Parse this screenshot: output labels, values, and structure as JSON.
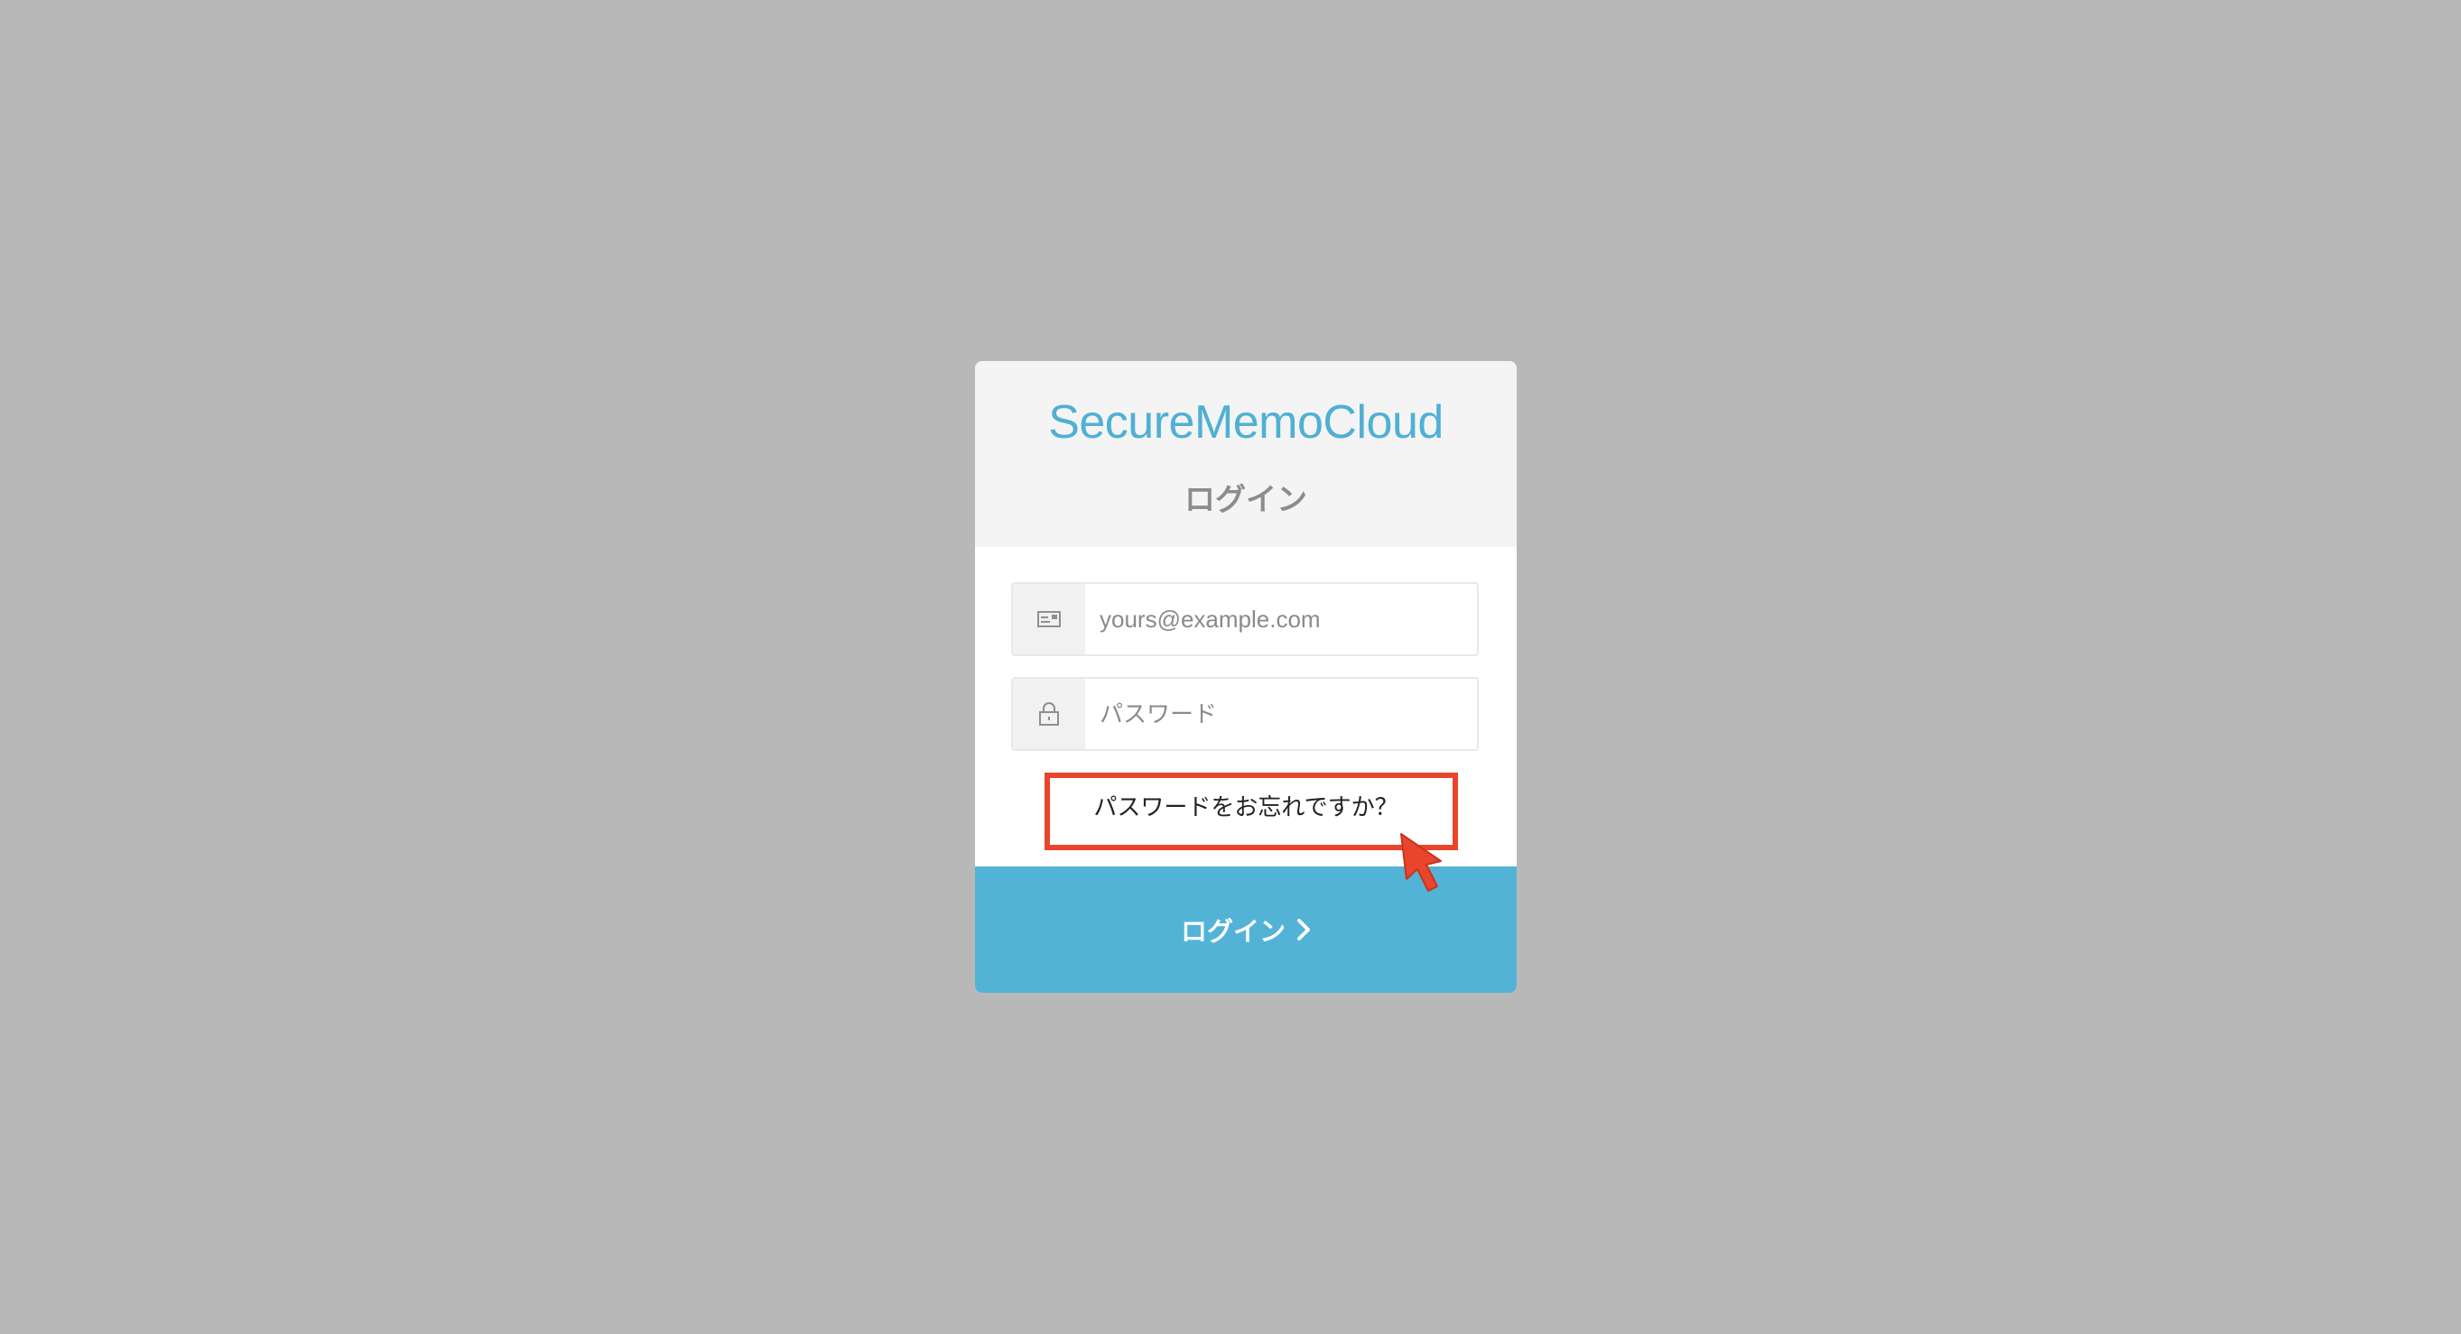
{
  "app": {
    "title": "SecureMemoCloud",
    "heading": "ログイン"
  },
  "form": {
    "email": {
      "placeholder": "yours@example.com",
      "value": "",
      "icon": "email-icon"
    },
    "password": {
      "placeholder": "パスワード",
      "value": "",
      "icon": "lock-icon"
    },
    "forgot_link": "パスワードをお忘れですか？",
    "submit_label": "ログイン",
    "submit_icon": "chevron-right-icon"
  },
  "annotation": {
    "highlight": "forgot-password-link",
    "pointer": "arrow-cursor-icon"
  },
  "colors": {
    "background": "#b8b8b8",
    "brand": "#4fb0d4",
    "button": "#53b3d7",
    "header_bg": "#f4f4f4",
    "highlight": "#e8452c"
  }
}
